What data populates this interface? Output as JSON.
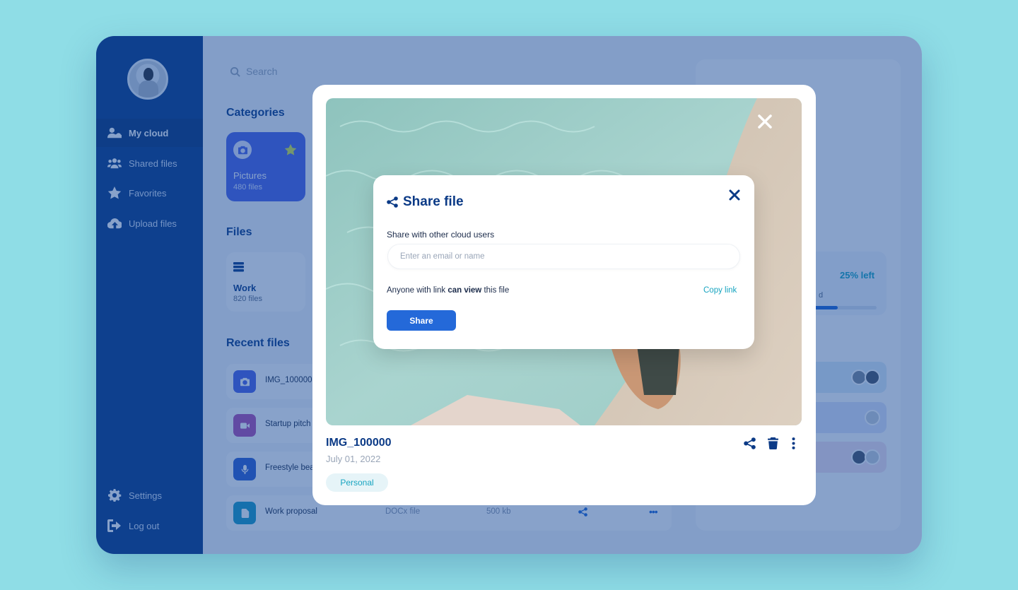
{
  "sidebar": {
    "items": [
      {
        "label": "My cloud",
        "icon": "user-cloud-icon",
        "active": true
      },
      {
        "label": "Shared files",
        "icon": "users-icon"
      },
      {
        "label": "Favorites",
        "icon": "star-icon"
      },
      {
        "label": "Upload files",
        "icon": "cloud-upload-icon"
      }
    ],
    "bottom": [
      {
        "label": "Settings",
        "icon": "gear-icon"
      },
      {
        "label": "Log out",
        "icon": "logout-icon"
      }
    ]
  },
  "search": {
    "placeholder": "Search"
  },
  "categories": {
    "title": "Categories",
    "cards": [
      {
        "label": "Pictures",
        "count": "480 files"
      }
    ]
  },
  "files": {
    "title": "Files",
    "cards": [
      {
        "label": "Work",
        "count": "820 files"
      }
    ]
  },
  "recent": {
    "title": "Recent files",
    "rows": [
      {
        "name": "IMG_100000",
        "type": "",
        "size": "",
        "color": "#4d62e6"
      },
      {
        "name": "Startup pitch",
        "type": "",
        "size": "",
        "color": "#b04fb0"
      },
      {
        "name": "Freestyle beat",
        "type": "",
        "size": "",
        "color": "#2f5fd0"
      },
      {
        "name": "Work proposal",
        "type": "DOCx file",
        "size": "500 kb",
        "color": "#1a9bc4"
      }
    ]
  },
  "right_panel": {
    "files_fragment": "iles",
    "storage_left": "25% left",
    "storage_used_fragment": "d",
    "storage_used_fraction": 0.75
  },
  "viewer": {
    "file_name": "IMG_100000",
    "date": "July 01, 2022",
    "tag": "Personal"
  },
  "share_modal": {
    "title": "Share file",
    "label": "Share with other cloud users",
    "input_placeholder": "Enter an email or name",
    "link_prefix": "Anyone with link",
    "link_permission": "can view",
    "link_suffix": "this file",
    "copy_link": "Copy link",
    "share_button": "Share"
  },
  "colors": {
    "background": "#8fdde6",
    "sidebar": "#0b3a86",
    "accent": "#2469d9",
    "teal": "#17a4c0"
  }
}
